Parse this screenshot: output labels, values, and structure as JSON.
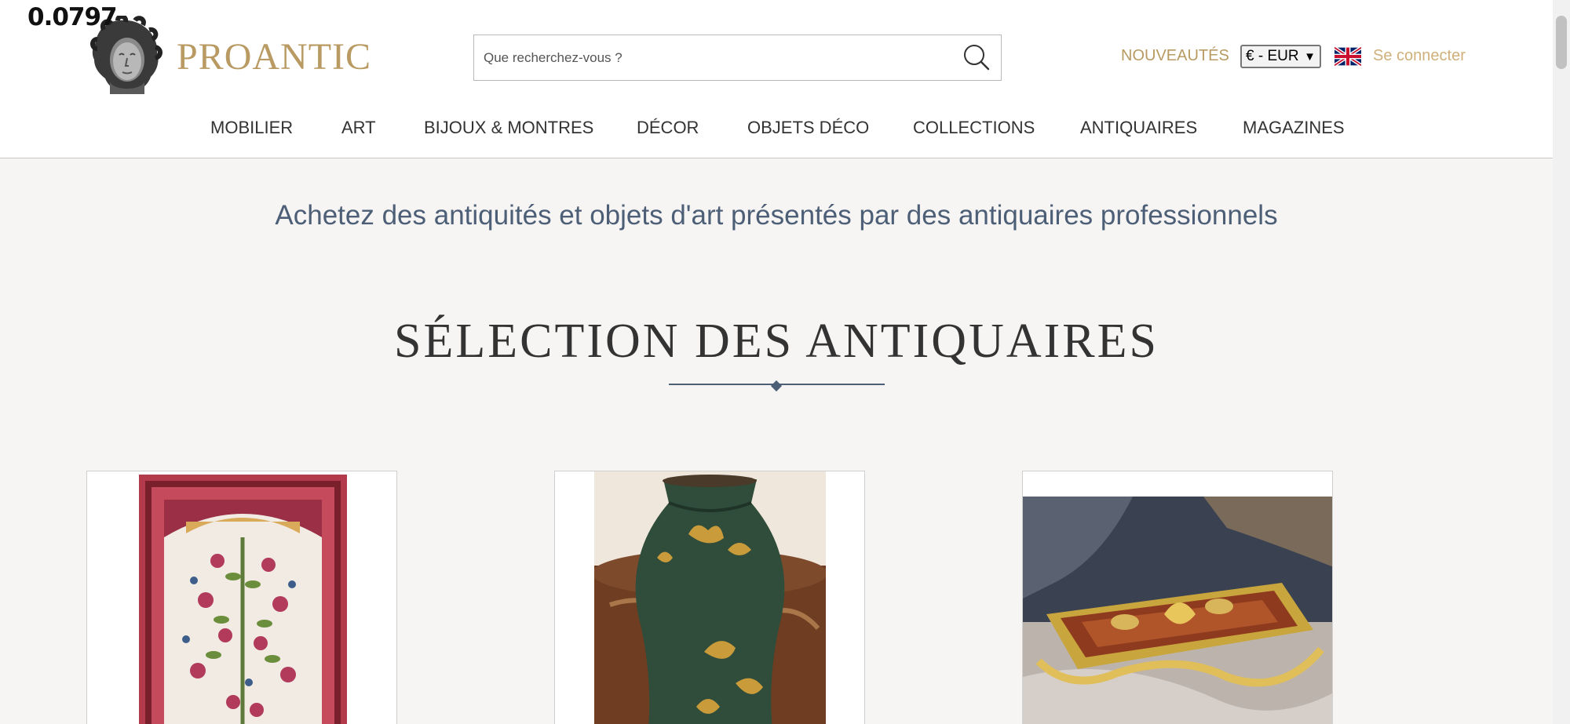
{
  "overlay": {
    "value": "0.0797"
  },
  "header": {
    "logo_text": "PROANTIC",
    "search": {
      "placeholder": "Que recherchez-vous ?"
    },
    "nouveautes": "NOUVEAUTÉS",
    "currency": {
      "selected": "€ - EUR"
    },
    "language_icon": "uk-flag-icon",
    "login": "Se connecter",
    "colors": {
      "gold": "#b89a62",
      "login": "#cfb07a"
    }
  },
  "nav": {
    "items": [
      {
        "label": "MOBILIER"
      },
      {
        "label": "ART"
      },
      {
        "label": "BIJOUX & MONTRES"
      },
      {
        "label": "DÉCOR"
      },
      {
        "label": "OBJETS DÉCO"
      },
      {
        "label": "COLLECTIONS"
      },
      {
        "label": "ANTIQUAIRES"
      },
      {
        "label": "MAGAZINES"
      }
    ]
  },
  "main": {
    "tagline": "Achetez des antiquités et objets d'art présentés par des antiquaires professionnels",
    "section_title": "SÉLECTION DES ANTIQUAIRES",
    "accent": "#4c5f77",
    "cards": [
      {
        "image": "persian-rug-image"
      },
      {
        "image": "green-vase-image"
      },
      {
        "image": "gilt-inkstand-image"
      }
    ]
  }
}
